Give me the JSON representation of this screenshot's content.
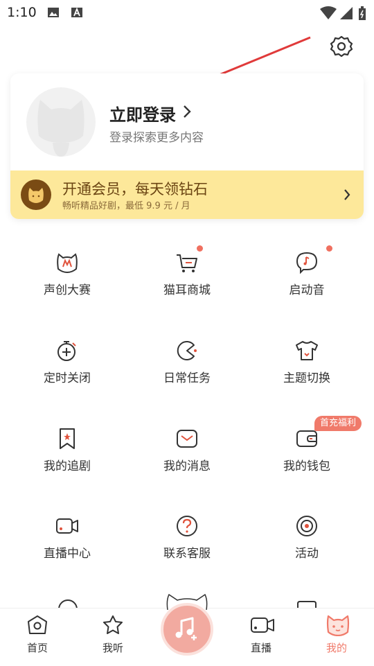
{
  "status_bar": {
    "time": "1:10"
  },
  "profile": {
    "login_title": "立即登录",
    "login_subtitle": "登录探索更多内容"
  },
  "vip": {
    "title": "开通会员，每天领钻石",
    "subtitle": "畅听精品好剧，最低 9.9 元 / 月"
  },
  "grid": [
    {
      "label": "声创大赛",
      "icon": "cat-mic-icon"
    },
    {
      "label": "猫耳商城",
      "icon": "cart-icon",
      "dot": true
    },
    {
      "label": "启动音",
      "icon": "music-bubble-icon",
      "dot": true
    },
    {
      "label": "定时关闭",
      "icon": "timer-icon"
    },
    {
      "label": "日常任务",
      "icon": "pacman-icon"
    },
    {
      "label": "主题切换",
      "icon": "tshirt-icon"
    },
    {
      "label": "我的追剧",
      "icon": "bookmark-icon"
    },
    {
      "label": "我的消息",
      "icon": "message-icon"
    },
    {
      "label": "我的钱包",
      "icon": "wallet-icon",
      "badge": "首充福利"
    },
    {
      "label": "直播中心",
      "icon": "camera-icon"
    },
    {
      "label": "联系客服",
      "icon": "help-icon"
    },
    {
      "label": "活动",
      "icon": "target-icon"
    }
  ],
  "tabs": [
    {
      "label": "首页",
      "icon": "home-icon"
    },
    {
      "label": "我听",
      "icon": "star-icon"
    },
    {
      "label": "直播",
      "icon": "video-icon"
    },
    {
      "label": "我的",
      "icon": "cat-face-icon",
      "active": true
    }
  ],
  "colors": {
    "accent": "#f07a6a",
    "vip_bg": "#fde89a",
    "vip_text": "#6b4513"
  }
}
